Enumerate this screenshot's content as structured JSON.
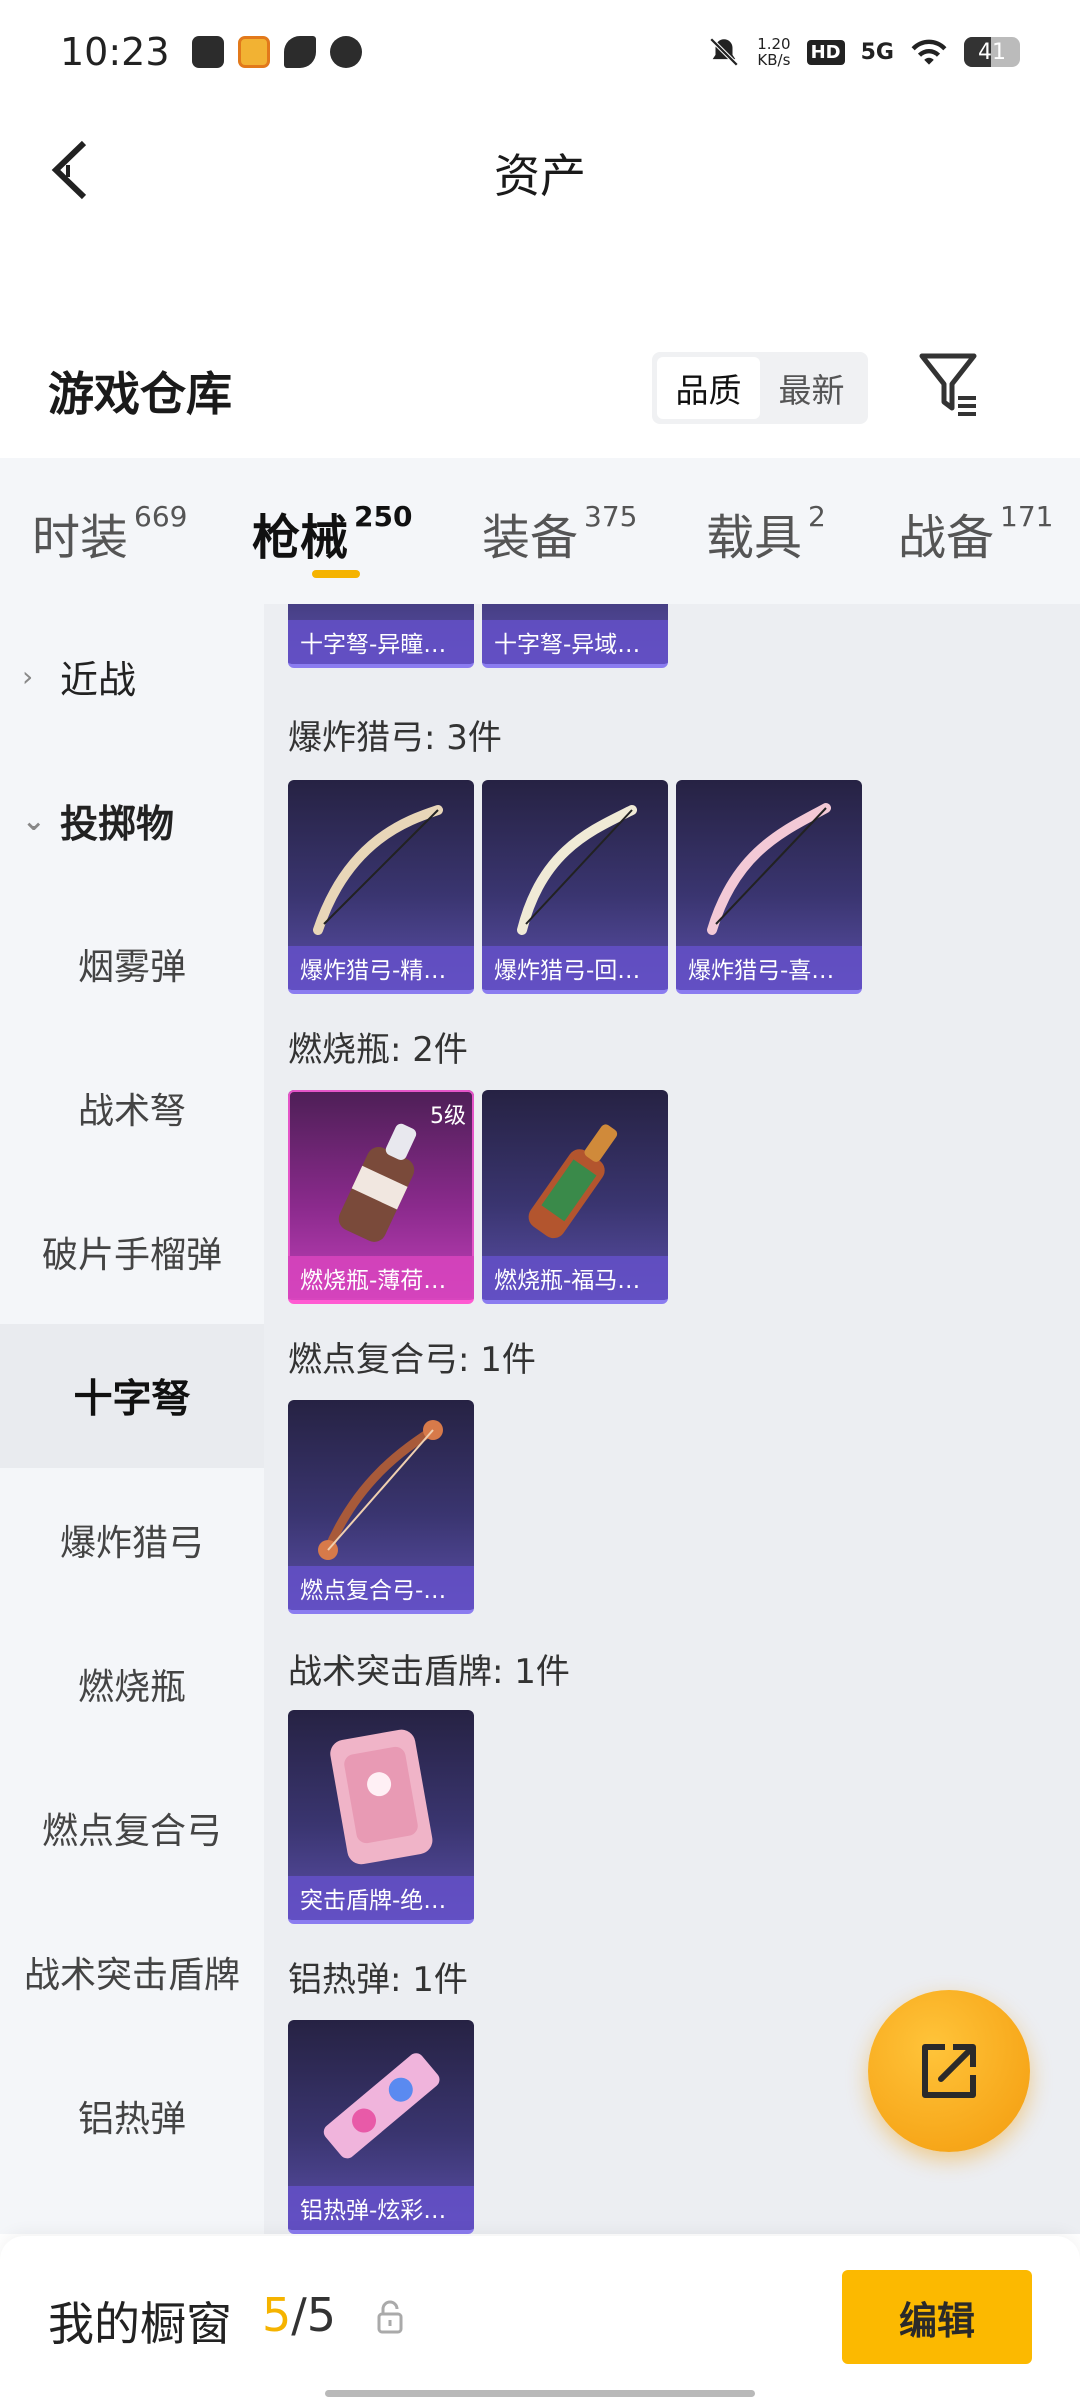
{
  "status_bar": {
    "time": "10:23",
    "net_speed_value": "1.20",
    "net_speed_unit": "KB/s",
    "hd_badge": "HD",
    "network": "5G",
    "battery": "41",
    "icons": [
      "chat-icon",
      "app-icon",
      "leaf-icon",
      "bubble-icon",
      "mute-icon",
      "wifi-icon",
      "battery-icon"
    ]
  },
  "header": {
    "title": "资产",
    "back_icon": "chevron-left-icon"
  },
  "warehouse": {
    "title": "游戏仓库",
    "sort_options": [
      "品质",
      "最新"
    ],
    "sort_active": "品质",
    "filter_icon": "filter-icon"
  },
  "category_tabs": [
    {
      "label": "时装",
      "count": "669"
    },
    {
      "label": "枪械",
      "count": "250",
      "active": true
    },
    {
      "label": "装备",
      "count": "375"
    },
    {
      "label": "载具",
      "count": "2"
    },
    {
      "label": "战备",
      "count": "171"
    }
  ],
  "sidebar": {
    "groups": [
      {
        "label": "近战",
        "expanded": false
      },
      {
        "label": "投掷物",
        "expanded": true
      }
    ],
    "items": [
      "烟雾弹",
      "战术弩",
      "破片手榴弹",
      "十字弩",
      "爆炸猎弓",
      "燃烧瓶",
      "燃点复合弓",
      "战术突击盾牌",
      "铝热弹"
    ],
    "active_item": "十字弩"
  },
  "content": {
    "partial_cards": [
      "十字弩-异瞳…",
      "十字弩-异域…"
    ],
    "sections": [
      {
        "title": "爆炸猎弓: 3件",
        "cards": [
          "爆炸猎弓-精…",
          "爆炸猎弓-回…",
          "爆炸猎弓-喜…"
        ]
      },
      {
        "title": "燃烧瓶: 2件",
        "cards": [
          "燃烧瓶-薄荷…",
          "燃烧瓶-福马…"
        ],
        "badge": "5级"
      },
      {
        "title": "燃点复合弓: 1件",
        "cards": [
          "燃点复合弓-…"
        ]
      },
      {
        "title": "战术突击盾牌: 1件",
        "cards": [
          "突击盾牌-绝…"
        ]
      },
      {
        "title": "铝热弹: 1件",
        "cards": [
          "铝热弹-炫彩…"
        ]
      }
    ]
  },
  "fab": {
    "icon": "share-external-icon"
  },
  "bottom_bar": {
    "title": "我的橱窗",
    "current": "5",
    "separator": "/",
    "max": "5",
    "lock_icon": "lock-icon",
    "edit_label": "编辑"
  },
  "colors": {
    "accent": "#fcb900",
    "card_purple": "#3a3570",
    "card_pink": "#c040b8",
    "sidebar_bg": "#f4f6f9",
    "content_bg": "#eceef2"
  }
}
